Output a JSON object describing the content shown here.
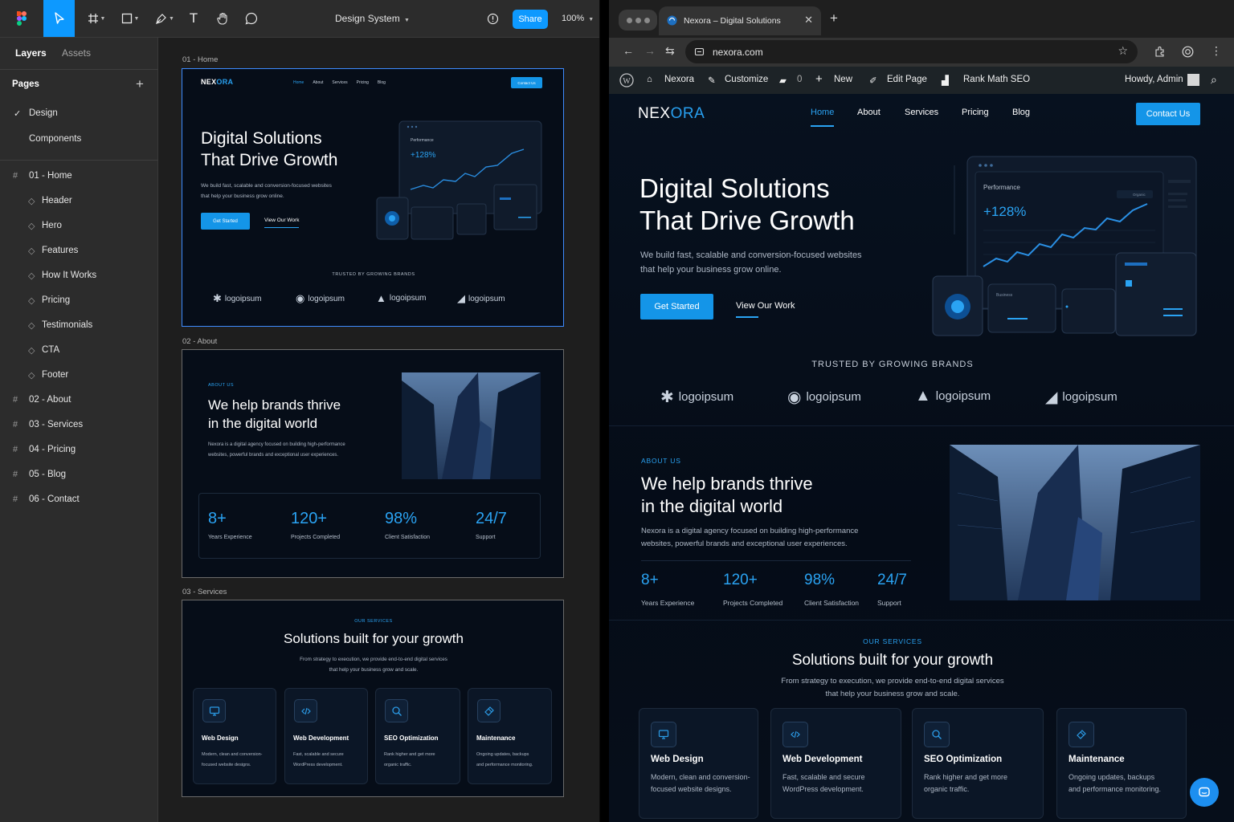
{
  "figma": {
    "file_name": "Design System",
    "share_label": "Share",
    "zoom": "100%",
    "tabs": {
      "layers": "Layers",
      "assets": "Assets"
    },
    "pages_title": "Pages",
    "pages": [
      "Design",
      "Components"
    ],
    "layers": [
      {
        "label": "01 - Home",
        "type": "frame"
      },
      {
        "label": "Header",
        "type": "component"
      },
      {
        "label": "Hero",
        "type": "component"
      },
      {
        "label": "Features",
        "type": "component"
      },
      {
        "label": "How It Works",
        "type": "component"
      },
      {
        "label": "Pricing",
        "type": "component"
      },
      {
        "label": "Testimonials",
        "type": "component"
      },
      {
        "label": "CTA",
        "type": "component"
      },
      {
        "label": "Footer",
        "type": "component"
      },
      {
        "label": "02 - About",
        "type": "frame"
      },
      {
        "label": "03 - Services",
        "type": "frame"
      },
      {
        "label": "04 - Pricing",
        "type": "frame"
      },
      {
        "label": "05 - Blog",
        "type": "frame"
      },
      {
        "label": "06 - Contact",
        "type": "frame"
      }
    ],
    "frame_labels": [
      "01 - Home",
      "02 - About",
      "03 - Services"
    ]
  },
  "browser": {
    "tab_title": "Nexora – Digital Solutions",
    "url": "nexora.com",
    "wp_bar": {
      "site": "Nexora",
      "customize": "Customize",
      "comments": "0",
      "new": "New",
      "edit": "Edit Page",
      "seo": "Rank Math SEO",
      "howdy": "Howdy, Admin"
    }
  },
  "site": {
    "logo_a": "NEX",
    "logo_b": "ORA",
    "nav": [
      "Home",
      "About",
      "Services",
      "Pricing",
      "Blog"
    ],
    "contact_label": "Contact Us",
    "hero": {
      "title_1": "Digital Solutions",
      "title_2": "That Drive Growth",
      "desc_1": "We build fast, scalable and conversion-focused websites",
      "desc_2": "that help your business grow online.",
      "cta_primary": "Get Started",
      "cta_secondary": "View Our Work"
    },
    "dashboard": {
      "title": "Performance",
      "value": "+128%",
      "filter": "Organic",
      "card_label": "Business"
    },
    "trusted": "TRUSTED BY GROWING BRANDS",
    "logo_word": "logoipsum",
    "about": {
      "eyebrow": "ABOUT US",
      "title_1": "We help brands thrive",
      "title_2": "in the digital world",
      "desc_1": "Nexora is a digital agency focused on building high-performance",
      "desc_2": "websites, powerful brands and exceptional user experiences."
    },
    "stats": [
      {
        "value": "8+",
        "label": "Years Experience"
      },
      {
        "value": "120+",
        "label": "Projects Completed"
      },
      {
        "value": "98%",
        "label": "Client Satisfaction"
      },
      {
        "value": "24/7",
        "label": "Support"
      }
    ],
    "services": {
      "eyebrow": "OUR SERVICES",
      "title": "Solutions built for your growth",
      "desc_1": "From strategy to execution, we provide end-to-end digital services",
      "desc_2": "that help your business grow and scale.",
      "items": [
        {
          "title": "Web Design",
          "d1": "Modern, clean and conversion-",
          "d2": "focused website designs."
        },
        {
          "title": "Web Development",
          "d1": "Fast, scalable and secure",
          "d2": "WordPress development."
        },
        {
          "title": "SEO Optimization",
          "d1": "Rank higher and get more",
          "d2": "organic traffic."
        },
        {
          "title": "Maintenance",
          "d1": "Ongoing updates, backups",
          "d2": "and performance monitoring."
        }
      ]
    }
  },
  "colors": {
    "accent": "#1495e8",
    "figma_blue": "#0d99ff",
    "bg": "#050d18"
  }
}
